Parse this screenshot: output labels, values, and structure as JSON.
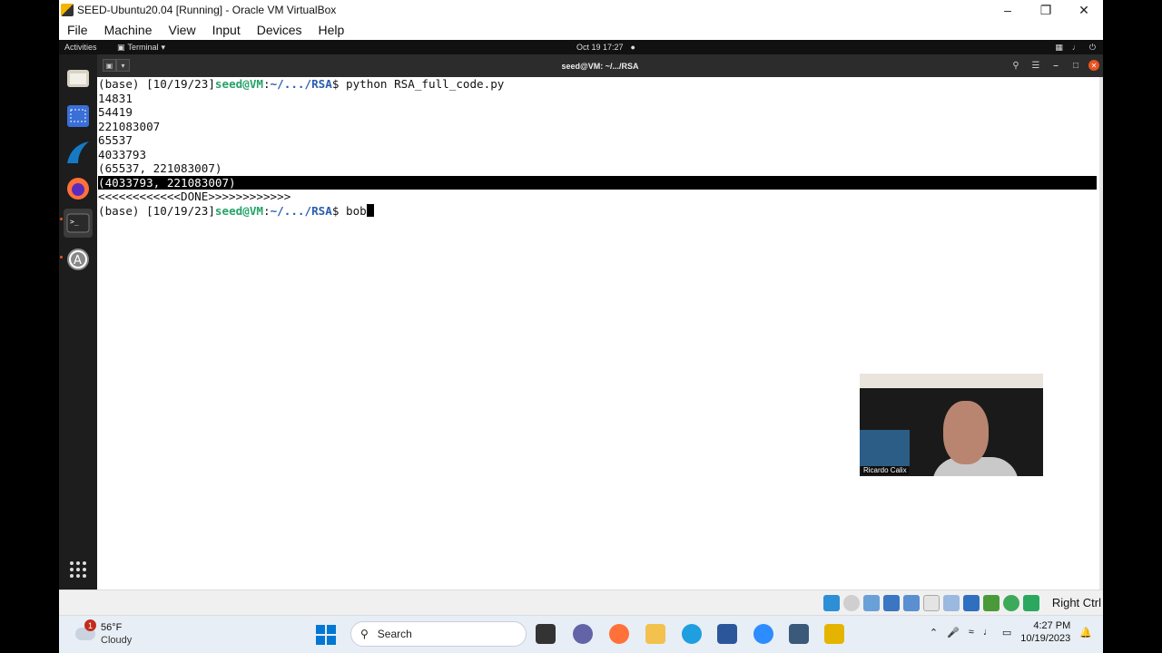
{
  "vbox": {
    "title": "SEED-Ubuntu20.04 [Running] - Oracle VM VirtualBox",
    "menu": [
      "File",
      "Machine",
      "View",
      "Input",
      "Devices",
      "Help"
    ],
    "host_key": "Right Ctrl"
  },
  "gnome": {
    "activities": "Activities",
    "app_menu": "Terminal",
    "clock": "Oct 19  17:27"
  },
  "terminal": {
    "title": "seed@VM: ~/.../RSA",
    "prompt": {
      "prefix": "(base) [10/19/23]",
      "user": "seed@VM",
      "sep": ":",
      "path": "~/.../RSA",
      "dollar": "$ "
    },
    "command1": "python RSA_full_code.py",
    "output": [
      "14831",
      "54419",
      "221083007",
      "65537",
      "4033793",
      "(65537, 221083007)"
    ],
    "highlighted_line": "(4033793, 221083007)",
    "done_line": "<<<<<<<<<<<<DONE>>>>>>>>>>>>",
    "command2": "bob"
  },
  "webcam": {
    "name": "Ricardo Calix"
  },
  "taskbar": {
    "weather_badge": "1",
    "temperature": "56°F",
    "condition": "Cloudy",
    "search_placeholder": "Search",
    "time": "4:27 PM",
    "date": "10/19/2023"
  },
  "colors": {
    "prompt_user": "#26a269",
    "prompt_path": "#2a5db0",
    "win_accent": "#0078d4"
  }
}
